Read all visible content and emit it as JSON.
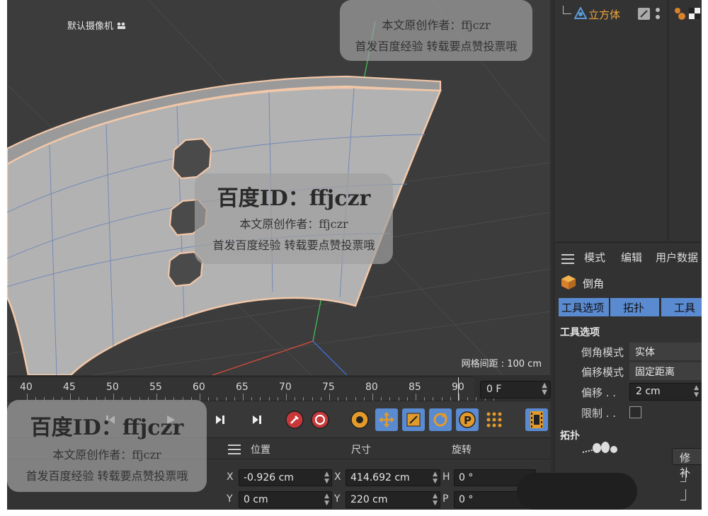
{
  "viewport": {
    "camera_label": "默认摄像机",
    "grid_spacing": "网格间距 : 100 cm"
  },
  "timeline": {
    "ticks": [
      "40",
      "45",
      "50",
      "55",
      "60",
      "65",
      "70",
      "75",
      "80",
      "85",
      "90"
    ],
    "current_frame": "0 F"
  },
  "coords": {
    "header": {
      "position": "位置",
      "size": "尺寸",
      "rotation": "旋转"
    },
    "rows": [
      {
        "axis": "X",
        "position": "-0.926 cm",
        "size_axis": "X",
        "size": "414.692 cm",
        "rot_axis": "H",
        "rotation": "0 °"
      },
      {
        "axis": "Y",
        "position": "0 cm",
        "size_axis": "Y",
        "size": "220 cm",
        "rot_axis": "P",
        "rotation": "0 °"
      }
    ]
  },
  "objects": {
    "object_name": "立方体"
  },
  "attributes": {
    "menu": [
      "模式",
      "编辑",
      "用户数据"
    ],
    "tool_name": "倒角",
    "tabs": [
      "工具选项",
      "拓扑",
      "工具"
    ],
    "section_tool_options": "工具选项",
    "bevel_mode_label": "倒角模式",
    "bevel_mode_value": "实体",
    "offset_mode_label": "偏移模式",
    "offset_mode_value": "固定距离",
    "offset_label": "偏移 . .",
    "offset_value": "2 cm",
    "limit_label": "限制 . .",
    "section_topology": "拓扑",
    "modify_button": "修补"
  },
  "watermark": {
    "id_line": "百度ID：ffjczr",
    "author_line": "本文原创作者：ffjczr",
    "publish_line": "首发百度经验 转载要点赞投票哦"
  },
  "colors": {
    "accent_orange": "#f0a53a",
    "tab_blue": "#5a8ad0",
    "selection_edge": "#f2c7a8",
    "axis_green": "#3fbf5a",
    "axis_red": "#d94a3f",
    "axis_blue": "#3f6fd9"
  }
}
